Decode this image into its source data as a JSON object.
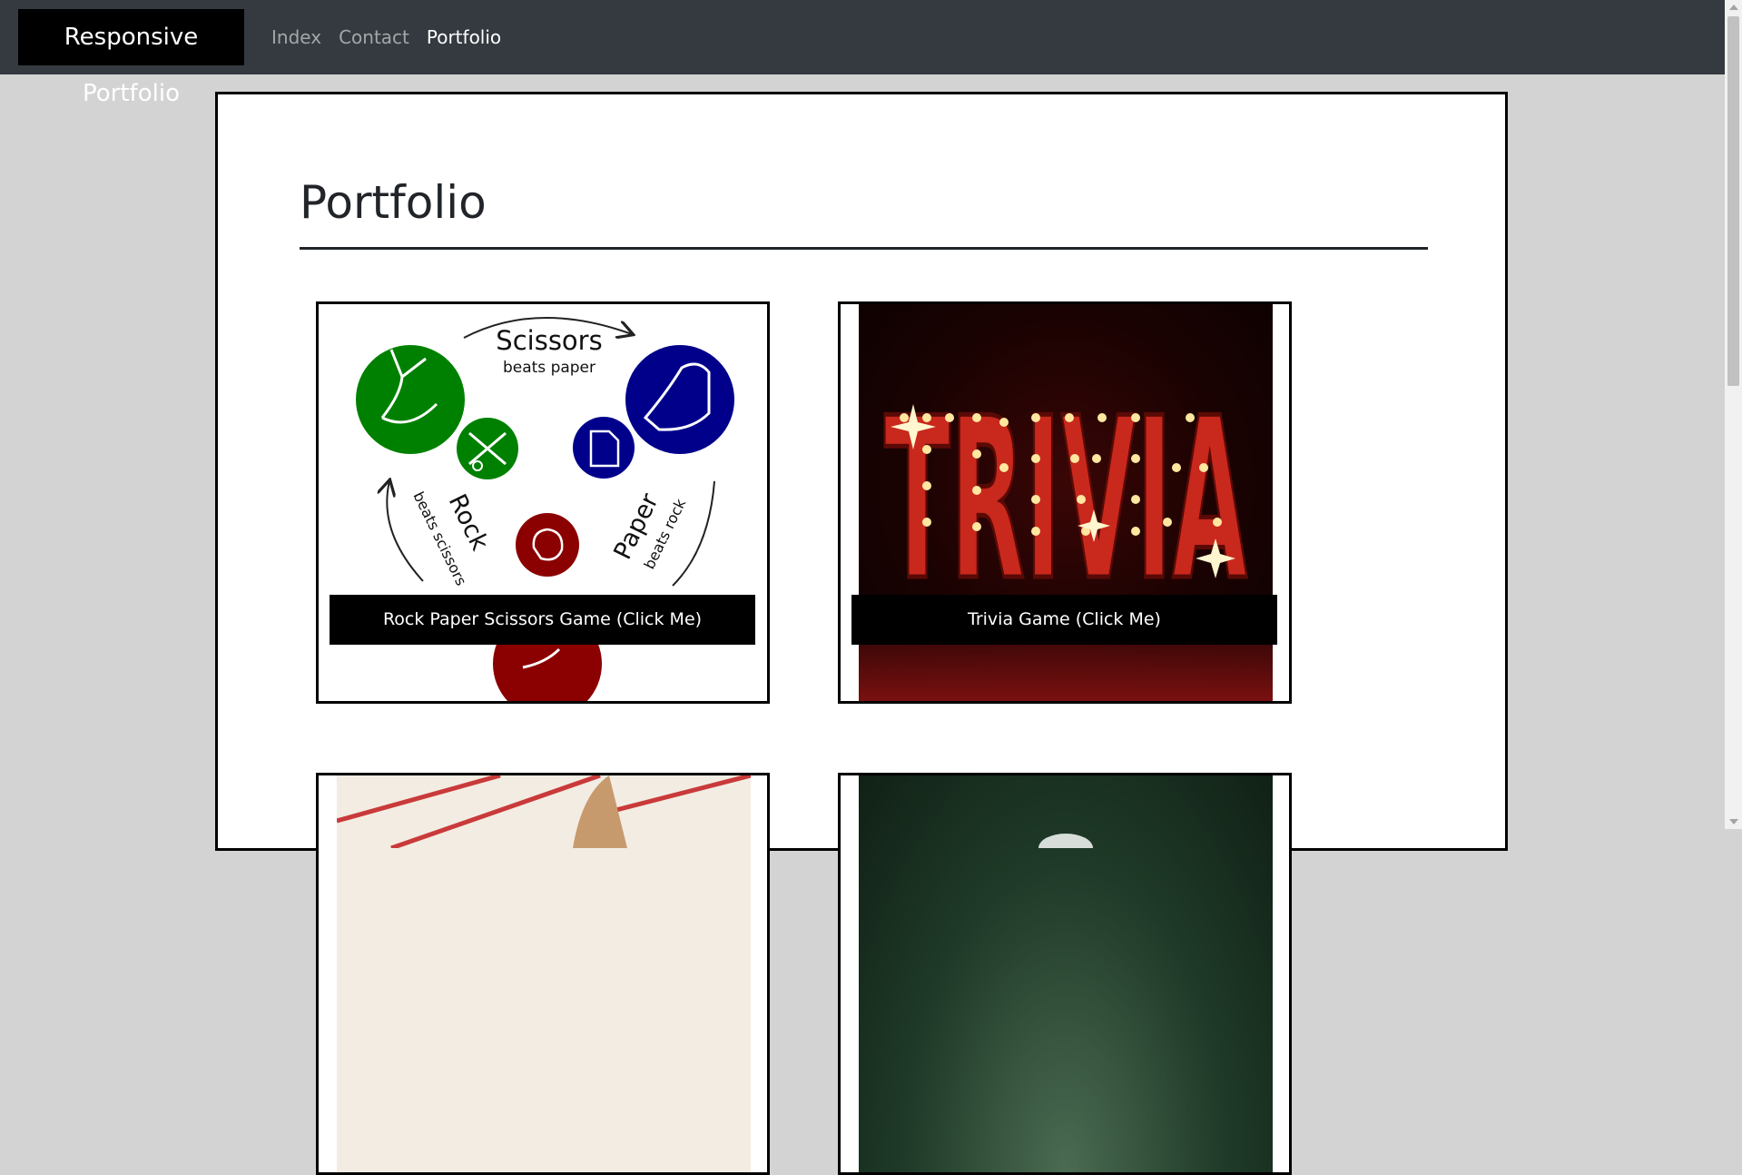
{
  "nav": {
    "brand": "Responsive Portfolio",
    "links": [
      {
        "label": "Index"
      },
      {
        "label": "Contact"
      },
      {
        "label": "Portfolio"
      }
    ]
  },
  "page": {
    "title": "Portfolio"
  },
  "cards": [
    {
      "label": "Rock Paper Scissors Game (Click Me)"
    },
    {
      "label": "Trivia Game (Click Me)"
    }
  ],
  "rps_image": {
    "scissors": "Scissors",
    "scissors_sub": "beats paper",
    "rock": "Rock",
    "rock_sub": "beats scissors",
    "paper": "Paper",
    "paper_sub": "beats rock"
  },
  "trivia_image": {
    "word": "TRIVIA"
  },
  "colors": {
    "navbar": "#343a40",
    "page_bg": "#d3d3d3",
    "green": "#008000",
    "blue": "#00008b",
    "red": "#8b0000"
  }
}
